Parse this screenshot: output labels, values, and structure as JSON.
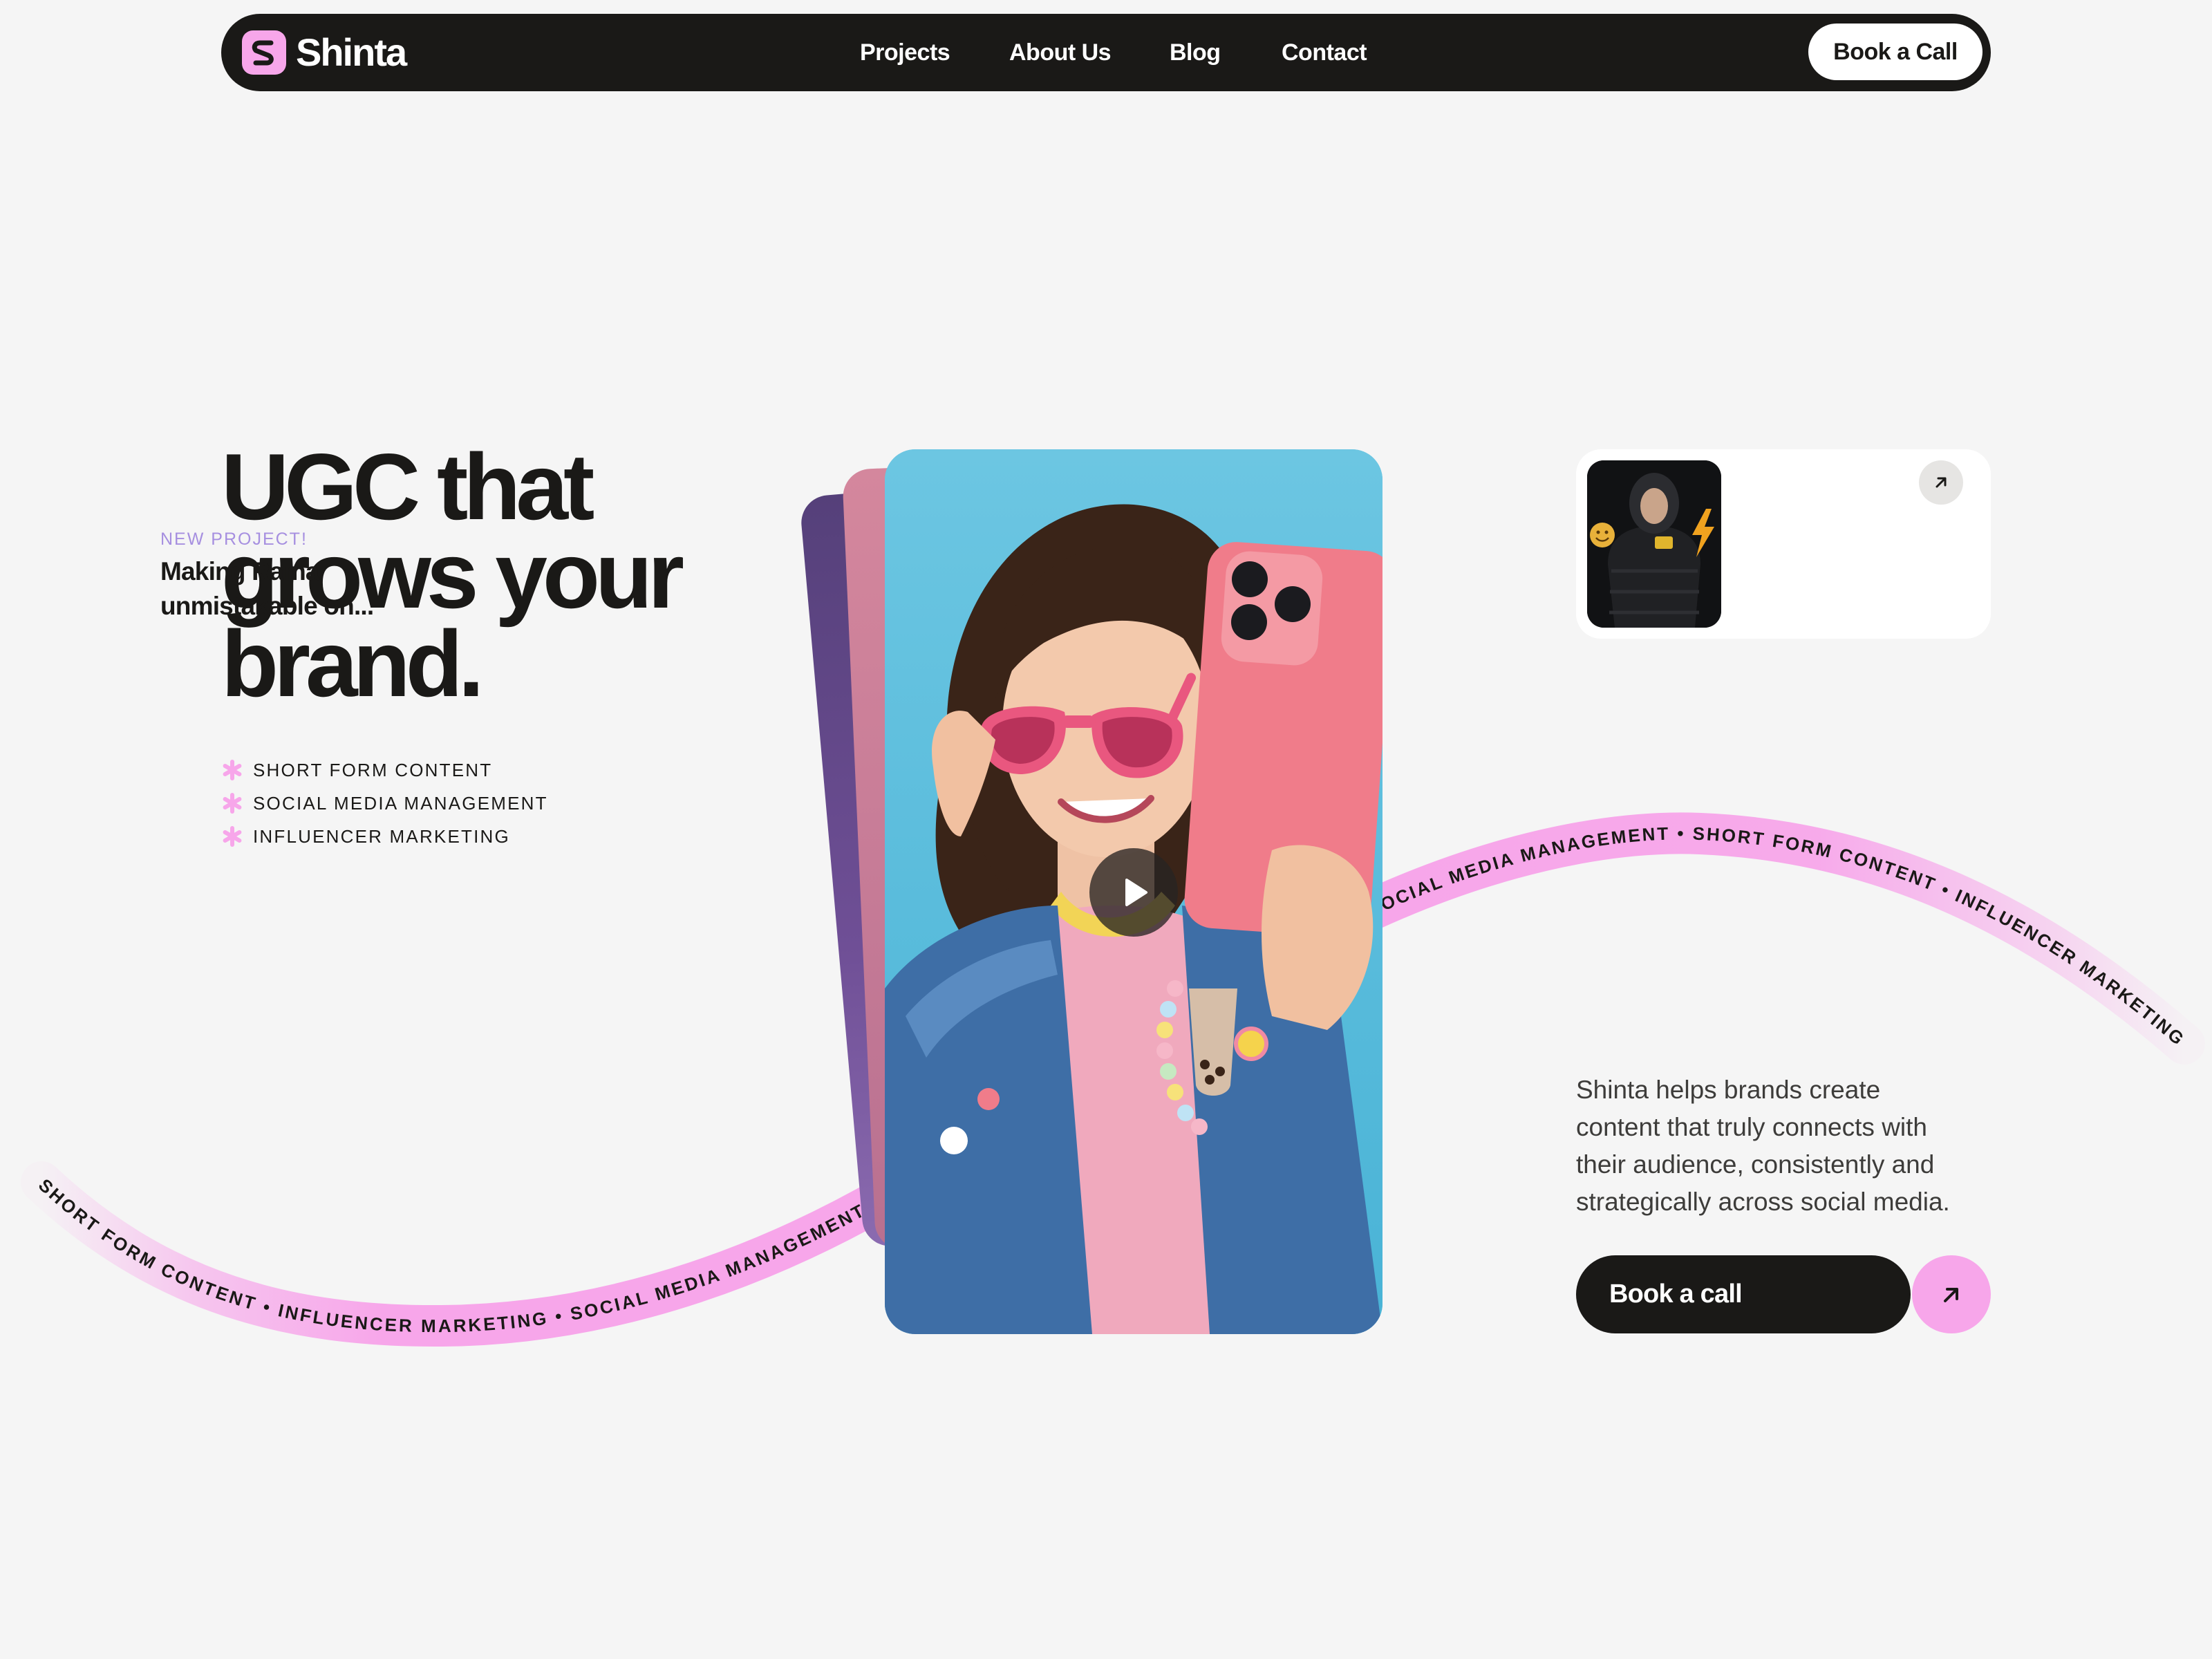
{
  "brand": {
    "name": "Shinta",
    "accent": "#f7a6ea",
    "dark": "#1a1917"
  },
  "nav": {
    "links": [
      "Projects",
      "About Us",
      "Blog",
      "Contact"
    ],
    "cta": "Book a Call"
  },
  "hero": {
    "title_lines": [
      "UGC that",
      "grows your",
      "brand."
    ],
    "services": [
      "SHORT FORM CONTENT",
      "SOCIAL MEDIA MANAGEMENT",
      "INFLUENCER MARKETING"
    ]
  },
  "marquee": {
    "text": "SHORT FORM CONTENT • INFLUENCER MARKETING • SOCIAL MEDIA MANAGEMENT • SHORT FORM CONTENT • INFLUENCER MARKETING • SOCIAL MEDIA MANAGEMENT • ",
    "upper_text": "SOCIAL MEDIA MANAGEMENT • SHORT FORM CONTENT • INFLUENCER MARKETING • SOCIAL MEDIA MANAGEMENT • SHORT FORM CONTENT • INFLUENCER MARKETING • "
  },
  "project": {
    "tag": "NEW PROJECT!",
    "title_lines": [
      "Making Rama",
      "unmistakable on..."
    ],
    "arrow_icon": "arrow-up-right-icon"
  },
  "description": {
    "lines": [
      "Shinta helps brands create",
      "content that truly connects with",
      "their audience, consistently and",
      "strategically across social media."
    ]
  },
  "cta": {
    "label": "Book a call",
    "arrow_icon": "arrow-up-right-icon"
  }
}
